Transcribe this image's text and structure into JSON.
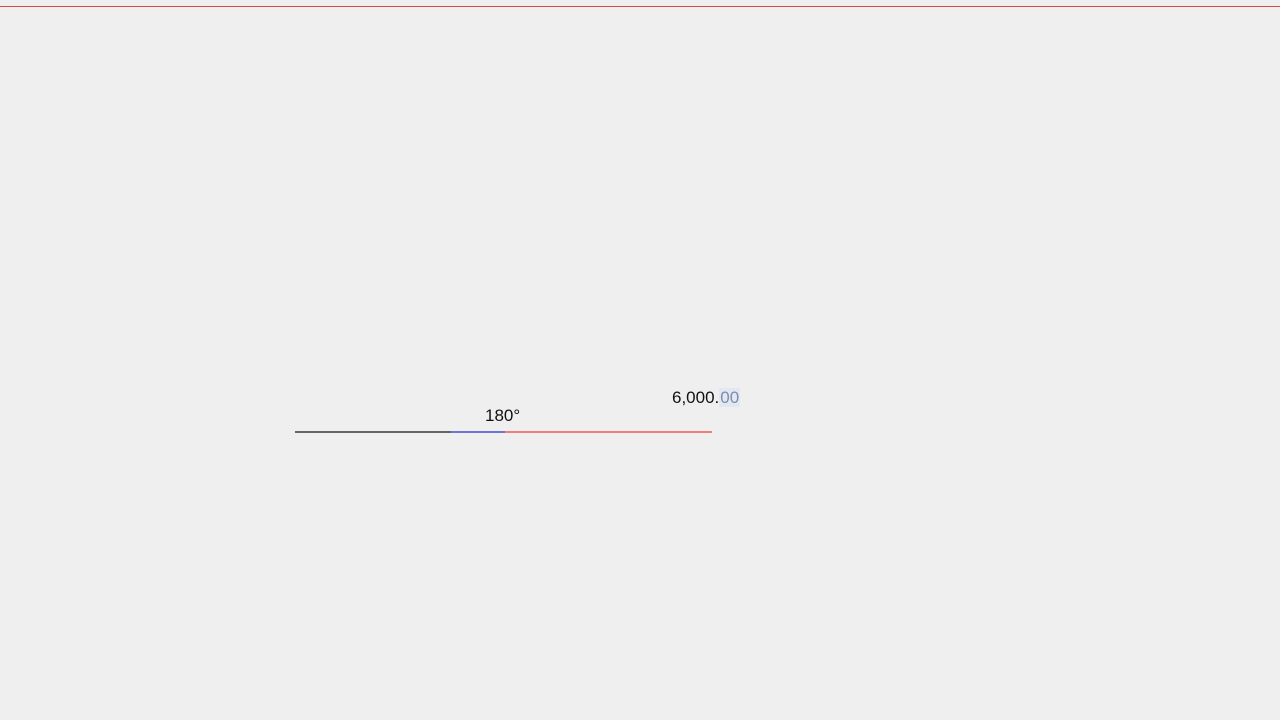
{
  "canvas": {
    "top_guide": {
      "color": "#d84a4a"
    },
    "dimension": {
      "angle_text": "180°",
      "length_main": "6,000.",
      "length_decimal": "00",
      "colors": {
        "base_line": "#666666",
        "angle_segment": "#6f74d8",
        "length_segment": "#ee7e7e",
        "decimal_highlight": "#e2e7f4"
      }
    }
  }
}
